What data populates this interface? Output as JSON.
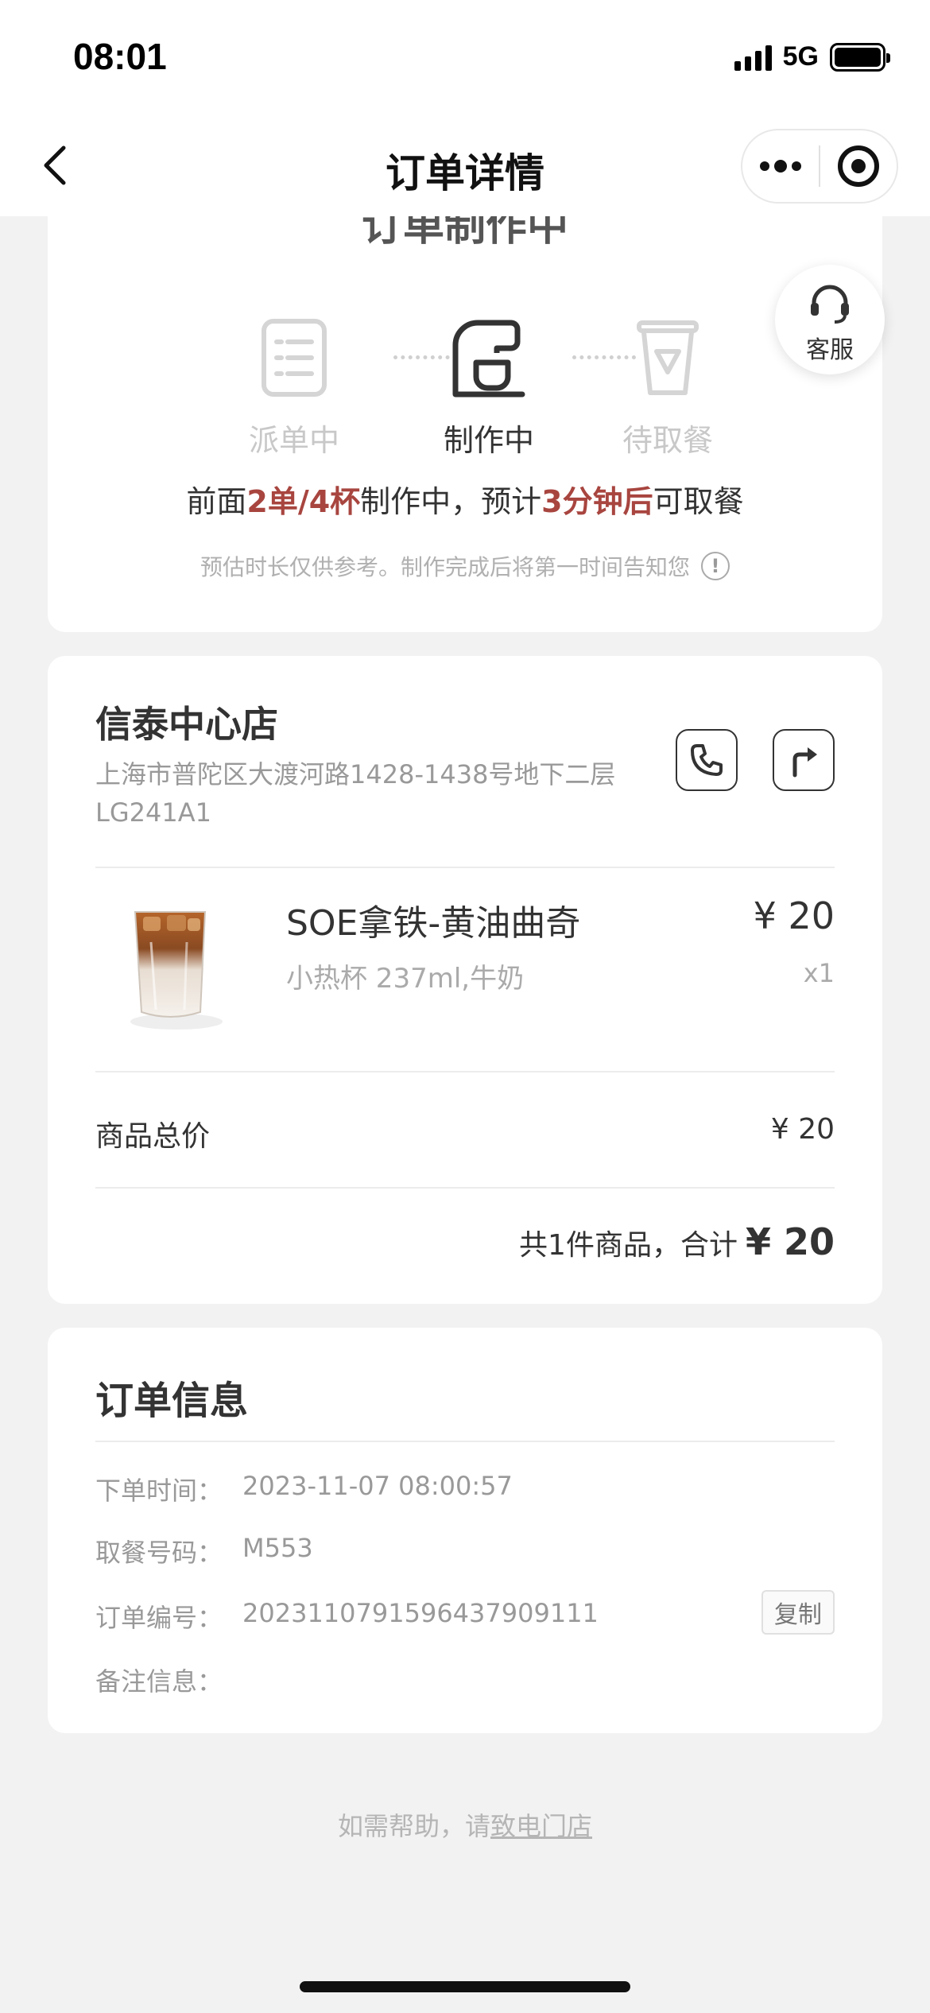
{
  "status_bar": {
    "time": "08:01",
    "network": "5G"
  },
  "nav": {
    "title": "订单详情"
  },
  "order_status": {
    "title_partial": "订单制作中",
    "steps": [
      {
        "label": "派单中",
        "state": "done"
      },
      {
        "label": "制作中",
        "state": "active"
      },
      {
        "label": "待取餐",
        "state": "pending"
      }
    ],
    "progress": {
      "prefix": "前面",
      "queue": "2单/4杯",
      "middle": "制作中，预计",
      "eta": "3分钟后",
      "suffix": "可取餐"
    },
    "note": "预估时长仅供参考。制作完成后将第一时间告知您"
  },
  "service": {
    "label": "客服"
  },
  "store": {
    "name": "信泰中心店",
    "address": "上海市普陀区大渡河路1428-1438号地下二层LG241A1"
  },
  "product": {
    "name": "SOE拿铁-黄油曲奇",
    "spec": "小热杯 237ml,牛奶",
    "price": "¥ 20",
    "qty": "x1"
  },
  "summary": {
    "subtotal_label": "商品总价",
    "subtotal_value": "¥ 20",
    "total_prefix": "共1件商品，合计",
    "total_value": "¥ 20"
  },
  "order_info": {
    "title": "订单信息",
    "rows": [
      {
        "key": "下单时间：",
        "value": "2023-11-07 08:00:57"
      },
      {
        "key": "取餐号码：",
        "value": "M553"
      },
      {
        "key": "订单编号：",
        "value": "2023110791596437909111"
      },
      {
        "key": "备注信息：",
        "value": ""
      }
    ],
    "copy_label": "复制"
  },
  "help": {
    "prefix": "如需帮助，请",
    "link": "致电门店"
  },
  "colors": {
    "accent": "#a8453f",
    "background": "#f2f2f2"
  }
}
